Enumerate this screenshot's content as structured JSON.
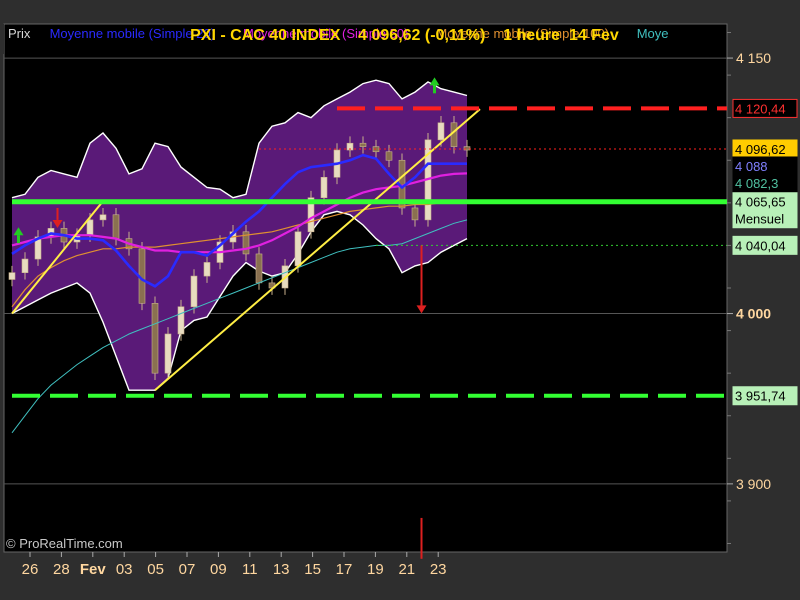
{
  "header": {
    "title": "PXI - CAC 40 INDEX",
    "price": "4 096,62",
    "change": "(-0,11%)",
    "interval": "1 heure",
    "date": "14 Fev"
  },
  "legend": [
    {
      "label": "Prix",
      "color": "#d8d8d8"
    },
    {
      "label": "Moyenne mobile (Simple 20)",
      "color": "#2a2aff"
    },
    {
      "label": "Moyenne mobile (Simple 50)",
      "color": "#e020e0"
    },
    {
      "label": "Moyenne mobile (Simple 100)",
      "color": "#e09030"
    },
    {
      "label": "Moye",
      "color": "#40c0c0"
    }
  ],
  "watermark": "© ProRealTime.com",
  "chart_data": {
    "type": "candlestick",
    "ylim": [
      3860,
      4170
    ],
    "y_ticks": [
      {
        "value": 4150,
        "label": "4 150"
      },
      {
        "value": 4000,
        "label": "4 000"
      },
      {
        "value": 3900,
        "label": "3 900"
      }
    ],
    "x_ticks": [
      "26",
      "28",
      "Fev",
      "03",
      "05",
      "07",
      "09",
      "11",
      "13",
      "15",
      "17",
      "19",
      "21",
      "23"
    ],
    "price_labels": [
      {
        "label": "4 120,44",
        "value": 4120.44,
        "bg": "#000000",
        "fg": "#ff3030",
        "border": "#ff3030"
      },
      {
        "label": "4 096,62",
        "value": 4096.62,
        "bg": "#ffcc00",
        "fg": "#000000",
        "border": "#ffcc00"
      },
      {
        "label": "4 088",
        "value": 4088,
        "bg": "#000000",
        "fg": "#8080ff",
        "border": "#000000"
      },
      {
        "label": "4 082,3",
        "value": 4082.3,
        "bg": "#000000",
        "fg": "#50c0a0",
        "border": "#000000"
      },
      {
        "label": "4 065,65",
        "value": 4065.65,
        "bg": "#b8f0b8",
        "fg": "#000000",
        "border": "#b8f0b8"
      },
      {
        "label": "Mensuel",
        "value": 4057,
        "bg": "#b8f0b8",
        "fg": "#000000",
        "border": "#b8f0b8"
      },
      {
        "label": "4 040,04",
        "value": 4040.04,
        "bg": "#b8f0b8",
        "fg": "#000000",
        "border": "#b8f0b8"
      },
      {
        "label": "3 951,74",
        "value": 3951.74,
        "bg": "#b8f0b8",
        "fg": "#000000",
        "border": "#b8f0b8"
      }
    ],
    "levels": [
      {
        "value": 4120.44,
        "color": "#ff2020",
        "style": "dashed-long",
        "from_idx": 25,
        "width": 4
      },
      {
        "value": 4096.62,
        "color": "#ff2020",
        "style": "dotted",
        "from_idx": 19,
        "width": 1
      },
      {
        "value": 4065.65,
        "color": "#33ff33",
        "style": "solid",
        "from_idx": 0,
        "width": 5
      },
      {
        "value": 4040.04,
        "color": "#33cc33",
        "style": "dotted",
        "from_idx": 28,
        "width": 1
      },
      {
        "value": 3951.74,
        "color": "#33ff33",
        "style": "dashed-long",
        "from_idx": 0,
        "width": 4
      }
    ],
    "close": [
      4024,
      4032,
      4045,
      4050,
      4042,
      4046,
      4055,
      4058,
      4044,
      4038,
      4006,
      3965,
      3988,
      4004,
      4022,
      4030,
      4042,
      4048,
      4035,
      4018,
      4015,
      4028,
      4048,
      4068,
      4080,
      4096,
      4100,
      4098,
      4095,
      4090,
      4062,
      4055,
      4102,
      4112,
      4098,
      4096
    ],
    "sma20": [
      4035,
      4040,
      4044,
      4047,
      4046,
      4044,
      4044,
      4043,
      4037,
      4028,
      4020,
      4016,
      4022,
      4036,
      4036,
      4034,
      4040,
      4047,
      4054,
      4060,
      4068,
      4076,
      4083,
      4086,
      4087,
      4088,
      4090,
      4093,
      4091,
      4082,
      4074,
      4080,
      4088,
      4088,
      4088,
      4088
    ],
    "sma50": [
      4040,
      4042,
      4044,
      4045,
      4046,
      4046,
      4046,
      4045,
      4044,
      4041,
      4039,
      4037,
      4037,
      4036,
      4036,
      4036,
      4036,
      4037,
      4038,
      4040,
      4043,
      4047,
      4051,
      4056,
      4060,
      4064,
      4068,
      4071,
      4073,
      4074,
      4075,
      4077,
      4079,
      4081,
      4082,
      4082.3
    ],
    "sma100": [
      4004,
      4014,
      4022,
      4027,
      4031,
      4034,
      4036,
      4038,
      4038,
      4039,
      4039,
      4039,
      4040,
      4041,
      4042,
      4043,
      4044,
      4045,
      4046,
      4047,
      4048,
      4050,
      4052,
      4054,
      4056,
      4058,
      4060,
      4061,
      4062,
      4063,
      4063,
      4064,
      4064,
      4065,
      4066,
      4066
    ],
    "sma_extra": [
      3930,
      3940,
      3950,
      3958,
      3964,
      3970,
      3975,
      3980,
      3984,
      3988,
      3991,
      3994,
      3997,
      4000,
      4003,
      4006,
      4009,
      4012,
      4015,
      4018,
      4021,
      4024,
      4027,
      4030,
      4033,
      4036,
      4038,
      4039,
      4040,
      4040,
      4041,
      4044,
      4047,
      4050,
      4053,
      4055
    ],
    "bb_upper": [
      4068,
      4070,
      4080,
      4084,
      4082,
      4080,
      4100,
      4106,
      4097,
      4082,
      4085,
      4100,
      4098,
      4086,
      4080,
      4074,
      4073,
      4068,
      4070,
      4100,
      4110,
      4112,
      4118,
      4115,
      4122,
      4126,
      4130,
      4135,
      4137,
      4135,
      4126,
      4130,
      4136,
      4132,
      4130,
      4128
    ],
    "bb_lower": [
      4000,
      4004,
      4008,
      4012,
      4015,
      4018,
      4012,
      3995,
      3975,
      3955,
      3955,
      3955,
      3962,
      3990,
      3996,
      3998,
      4010,
      4022,
      4030,
      4025,
      4022,
      4024,
      4035,
      4048,
      4058,
      4060,
      4058,
      4052,
      4044,
      4038,
      4024,
      4028,
      4030,
      4036,
      4040,
      4044
    ],
    "trendlines": [
      {
        "color": "#ffee44",
        "p1": {
          "idx": 0,
          "value": 4000
        },
        "p2": {
          "idx": 7,
          "value": 4066
        }
      },
      {
        "color": "#ffee44",
        "p1": {
          "idx": 11,
          "value": 3955
        },
        "p2": {
          "idx": 36,
          "value": 4120
        }
      }
    ],
    "arrows": [
      {
        "idx": 0.5,
        "value": 4046,
        "dir": "up",
        "color": "#22cc22"
      },
      {
        "idx": 3.5,
        "value": 4062,
        "dir": "down",
        "color": "#dd2020"
      },
      {
        "idx": 32.5,
        "value": 4134,
        "dir": "up",
        "color": "#22cc22"
      },
      {
        "idx": 31.5,
        "value": 4040,
        "dir": "down",
        "color": "#dd2020",
        "long": true
      }
    ],
    "marker_line": {
      "idx": 31.5,
      "from": 3880,
      "to": 3856,
      "color": "#dd2020"
    }
  }
}
